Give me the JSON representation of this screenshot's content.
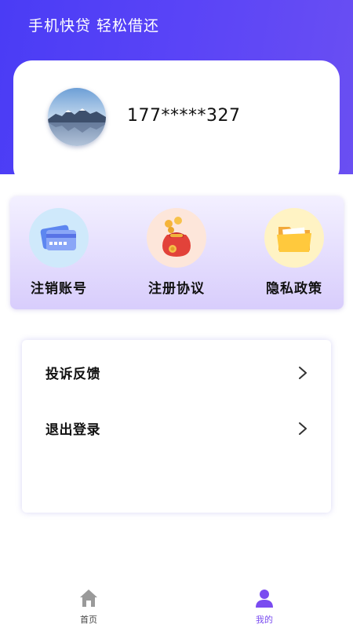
{
  "header": {
    "slogan": "手机快贷 轻松借还",
    "accent_color": "#4a3cf5"
  },
  "profile": {
    "phone": "177*****327",
    "avatar_icon": "landscape-avatar"
  },
  "actions": [
    {
      "label": "注销账号",
      "icon": "credit-card-icon",
      "circle_color": "#cfe9fb"
    },
    {
      "label": "注册协议",
      "icon": "money-bag-icon",
      "circle_color": "#fde6da"
    },
    {
      "label": "隐私政策",
      "icon": "folder-icon",
      "circle_color": "#fff3c4"
    }
  ],
  "menu": [
    {
      "label": "投诉反馈",
      "icon": "chevron-right-icon"
    },
    {
      "label": "退出登录",
      "icon": "chevron-right-icon"
    }
  ],
  "tabbar": {
    "home_label": "首页",
    "mine_label": "我的",
    "active_color": "#7a4cf0",
    "inactive_color": "#999999"
  }
}
